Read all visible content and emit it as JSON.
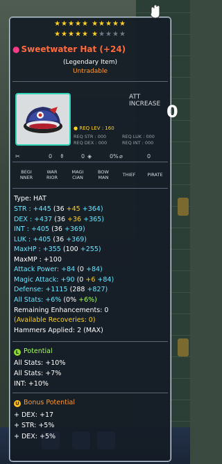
{
  "tooltip": {
    "stars_row1": 10,
    "stars_row2_filled": 5,
    "stars_row2_half": 1,
    "stars_row2_empty": 4,
    "item_name": "Sweetwater Hat (+24)",
    "grade": "(Legendary Item)",
    "trade_status": "Untradable",
    "att_increase_label": "ATT INCREASE",
    "att_increase_value": "0",
    "req_lev": "REQ LEV : 160",
    "req_str": "REQ STR : 000",
    "req_luk": "REQ LUK : 000",
    "req_dex": "REQ DEX : 000",
    "req_int": "REQ INT : 000",
    "icon_counts": [
      "0",
      "0",
      "0%",
      "0"
    ],
    "jobs": [
      {
        "l1": "BEGI",
        "l2": "NNER"
      },
      {
        "l1": "WAR",
        "l2": "RIOR"
      },
      {
        "l1": "MAGI",
        "l2": "CIAN"
      },
      {
        "l1": "BOW",
        "l2": "MAN"
      },
      {
        "l1": "THIEF",
        "l2": ""
      },
      {
        "l1": "PIRATE",
        "l2": ""
      }
    ],
    "type": "Type: HAT",
    "stats": {
      "str": {
        "label": "STR : +445",
        "a": "(36",
        "b": "+45",
        "c": "+364)"
      },
      "dex": {
        "label": "DEX : +437",
        "a": "(36",
        "b": "+36",
        "c": "+365)"
      },
      "int": {
        "label": "INT : +405",
        "a": "(36",
        "c": "+369)"
      },
      "luk": {
        "label": "LUK : +405",
        "a": "(36",
        "c": "+369)"
      },
      "maxhp": {
        "label": "MaxHP : +355",
        "a": "(100",
        "c": "+255)"
      },
      "maxmp": {
        "label": "MaxMP : +100"
      },
      "atk": {
        "label": "Attack Power: +84",
        "a": "(0",
        "c": "+84)"
      },
      "matk": {
        "label": "Magic Attack: +90",
        "a": "(0",
        "b": "+6",
        "c": "+84)"
      },
      "def": {
        "label": "Defense: +1115",
        "a": "(288",
        "c": "+827)"
      },
      "all": {
        "label": "All Stats: +6%",
        "a": "(0%",
        "c": "+6%)"
      }
    },
    "remaining": "Remaining Enhancements: 0",
    "recoveries": "(Available Recoveries: 0)",
    "hammers": "Hammers Applied: 2 (MAX)",
    "potential_title": "Potential",
    "potential_lines": [
      "All Stats: +10%",
      "All Stats: +7%",
      "INT: +10%"
    ],
    "bonus_title": "Bonus Potential",
    "bonus_lines": [
      "+ DEX: +17",
      "+ STR: +5%",
      "+ DEX: +5%"
    ]
  },
  "colors": {
    "name": "#ff6a3d",
    "legendary_badge": "#8bd82b",
    "unique_badge": "#ffc21c",
    "icon_border": "#2fd5b5"
  }
}
